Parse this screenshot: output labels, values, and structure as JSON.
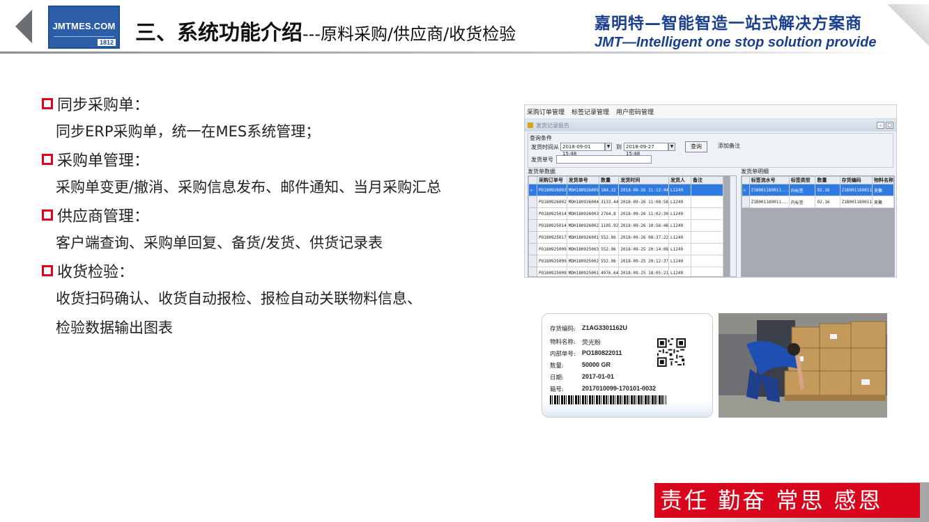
{
  "header": {
    "logo_text": "JMTMES.COM",
    "logo_number": "1812",
    "title_bold": "三、系统功能介绍",
    "title_rest": "---原料采购/供应商/收货检验",
    "company_cn": "嘉明特—智能智造一站式解决方案商",
    "company_en": "JMT—Intelligent one stop solution provide"
  },
  "sections": [
    {
      "heading": "同步采购单：",
      "lines": [
        "同步ERP采购单，统一在MES系统管理；"
      ]
    },
    {
      "heading": "采购单管理：",
      "lines": [
        "采购单变更/撤消、采购信息发布、邮件通知、当月采购汇总"
      ]
    },
    {
      "heading": "供应商管理：",
      "lines": [
        "客户端查询、采购单回复、备货/发货、供货记录表"
      ]
    },
    {
      "heading": "收货检验：",
      "lines": [
        "收货扫码确认、收货自动报检、报检自动关联物料信息、",
        "检验数据输出图表"
      ]
    }
  ],
  "app_screenshot": {
    "menu": [
      "采购订单管理",
      "标签记录管理",
      "用户密码管理"
    ],
    "window_title": "发货记录报告",
    "query_group": "查询条件",
    "date_label": "发货时间从",
    "date_from": "2018-09-01 15:48",
    "date_to_label": "到",
    "date_to": "2018-09-27 15:48",
    "query_button": "查询",
    "note_button": "添加备注",
    "ship_no_label": "发货单号",
    "left_caption": "发货单数据",
    "left_headers": [
      "采购订单号",
      "发货单号",
      "数量",
      "发货时间",
      "发货人",
      "备注"
    ],
    "left_rows": [
      [
        "PO180926002",
        "MDH180926005",
        "184.32",
        "2018-09-26 11:12:44",
        "L1249",
        ""
      ],
      [
        "PO180926002",
        "MDH180926004",
        "3133.44",
        "2018-09-26 11:08:58",
        "L1249",
        ""
      ],
      [
        "PO180925014",
        "MDH180926003",
        "2764.8",
        "2018-09-26 11:02:30",
        "L1249",
        ""
      ],
      [
        "PO180925014",
        "MDH180926002",
        "1105.92",
        "2018-09-26 10:56:48",
        "L1249",
        ""
      ],
      [
        "PO180925017",
        "MDH180926001",
        "552.96",
        "2018-09-26 08:37:22",
        "L1249",
        ""
      ],
      [
        "PO180925009",
        "MDH180925003",
        "552.96",
        "2018-09-25 20:14:08",
        "L1249",
        ""
      ],
      [
        "PO180925009",
        "MDH180925002",
        "552.96",
        "2018-09-25 20:12:37",
        "L1249",
        ""
      ],
      [
        "PO180925009",
        "MDH180925001",
        "4976.64",
        "2018-09-25 18:05:21",
        "L1249",
        ""
      ]
    ],
    "right_caption": "发货单明细",
    "right_headers": [
      "标签流水号",
      "标签类型",
      "数量",
      "存货编码",
      "物料名称"
    ],
    "right_rows": [
      [
        "Z1B001189011...",
        "内标签",
        "92.16",
        "Z1B001189011",
        "夹聚"
      ],
      [
        "Z1B001189011...",
        "内标签",
        "92.16",
        "Z1B001189011",
        "夹聚"
      ]
    ]
  },
  "label_card": {
    "rows": [
      {
        "key": "存货编码:",
        "value": "Z1AG3301162U"
      },
      {
        "key": "物料名称:",
        "value": "荧光粉"
      },
      {
        "key": "内部单号:",
        "value": "PO180822011"
      },
      {
        "key": "数量:",
        "value": "50000 GR"
      },
      {
        "key": "日期:",
        "value": "2017-01-01"
      },
      {
        "key": "箱号:",
        "value": "2017010099-170101-0032"
      }
    ]
  },
  "footer": {
    "slogan": "责任 勤奋 常思 感恩"
  },
  "colors": {
    "accent_red": "#d8051c",
    "brand_blue": "#1a3f8f",
    "bullet_red": "#e1001a",
    "selection_blue": "#2f7be3"
  }
}
